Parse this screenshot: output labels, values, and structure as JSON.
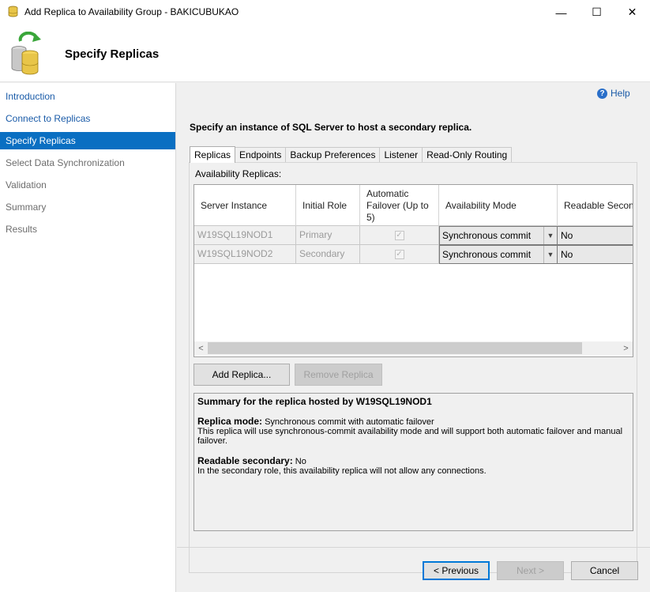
{
  "window": {
    "title": "Add Replica to Availability Group - BAKICUBUKAO",
    "minimize": "—",
    "maximize": "☐",
    "close": "✕"
  },
  "header": {
    "page_title": "Specify Replicas"
  },
  "sidebar": {
    "items": [
      {
        "label": "Introduction",
        "state": "link"
      },
      {
        "label": "Connect to Replicas",
        "state": "link"
      },
      {
        "label": "Specify Replicas",
        "state": "active"
      },
      {
        "label": "Select Data Synchronization",
        "state": "disabled"
      },
      {
        "label": "Validation",
        "state": "disabled"
      },
      {
        "label": "Summary",
        "state": "disabled"
      },
      {
        "label": "Results",
        "state": "disabled"
      }
    ]
  },
  "help": {
    "label": "Help",
    "icon": "help-icon"
  },
  "instruction": "Specify an instance of SQL Server to host a secondary replica.",
  "tabs": [
    "Replicas",
    "Endpoints",
    "Backup Preferences",
    "Listener",
    "Read-Only Routing"
  ],
  "replicas_tab": {
    "label": "Availability Replicas:",
    "columns": {
      "server": "Server Instance",
      "role": "Initial Role",
      "failover": "Automatic Failover (Up to 5)",
      "mode": "Availability Mode",
      "readable": "Readable Secondary"
    },
    "rows": [
      {
        "server": "W19SQL19NOD1",
        "role": "Primary",
        "failover": "✓",
        "mode": "Synchronous commit",
        "readable": "No"
      },
      {
        "server": "W19SQL19NOD2",
        "role": "Secondary",
        "failover": "✓",
        "mode": "Synchronous commit",
        "readable": "No"
      }
    ],
    "add_replica": "Add Replica...",
    "remove_replica": "Remove Replica"
  },
  "summary": {
    "title": "Summary for the replica hosted by W19SQL19NOD1",
    "mode_label": "Replica mode:",
    "mode_value": " Synchronous commit with automatic failover",
    "mode_desc": "This replica will use synchronous-commit availability mode and will support both automatic failover and manual failover.",
    "readable_label": "Readable secondary:",
    "readable_value": " No",
    "readable_desc": "In the secondary role, this availability replica will not allow any connections."
  },
  "footer": {
    "previous": "< Previous",
    "next": "Next >",
    "cancel": "Cancel"
  }
}
